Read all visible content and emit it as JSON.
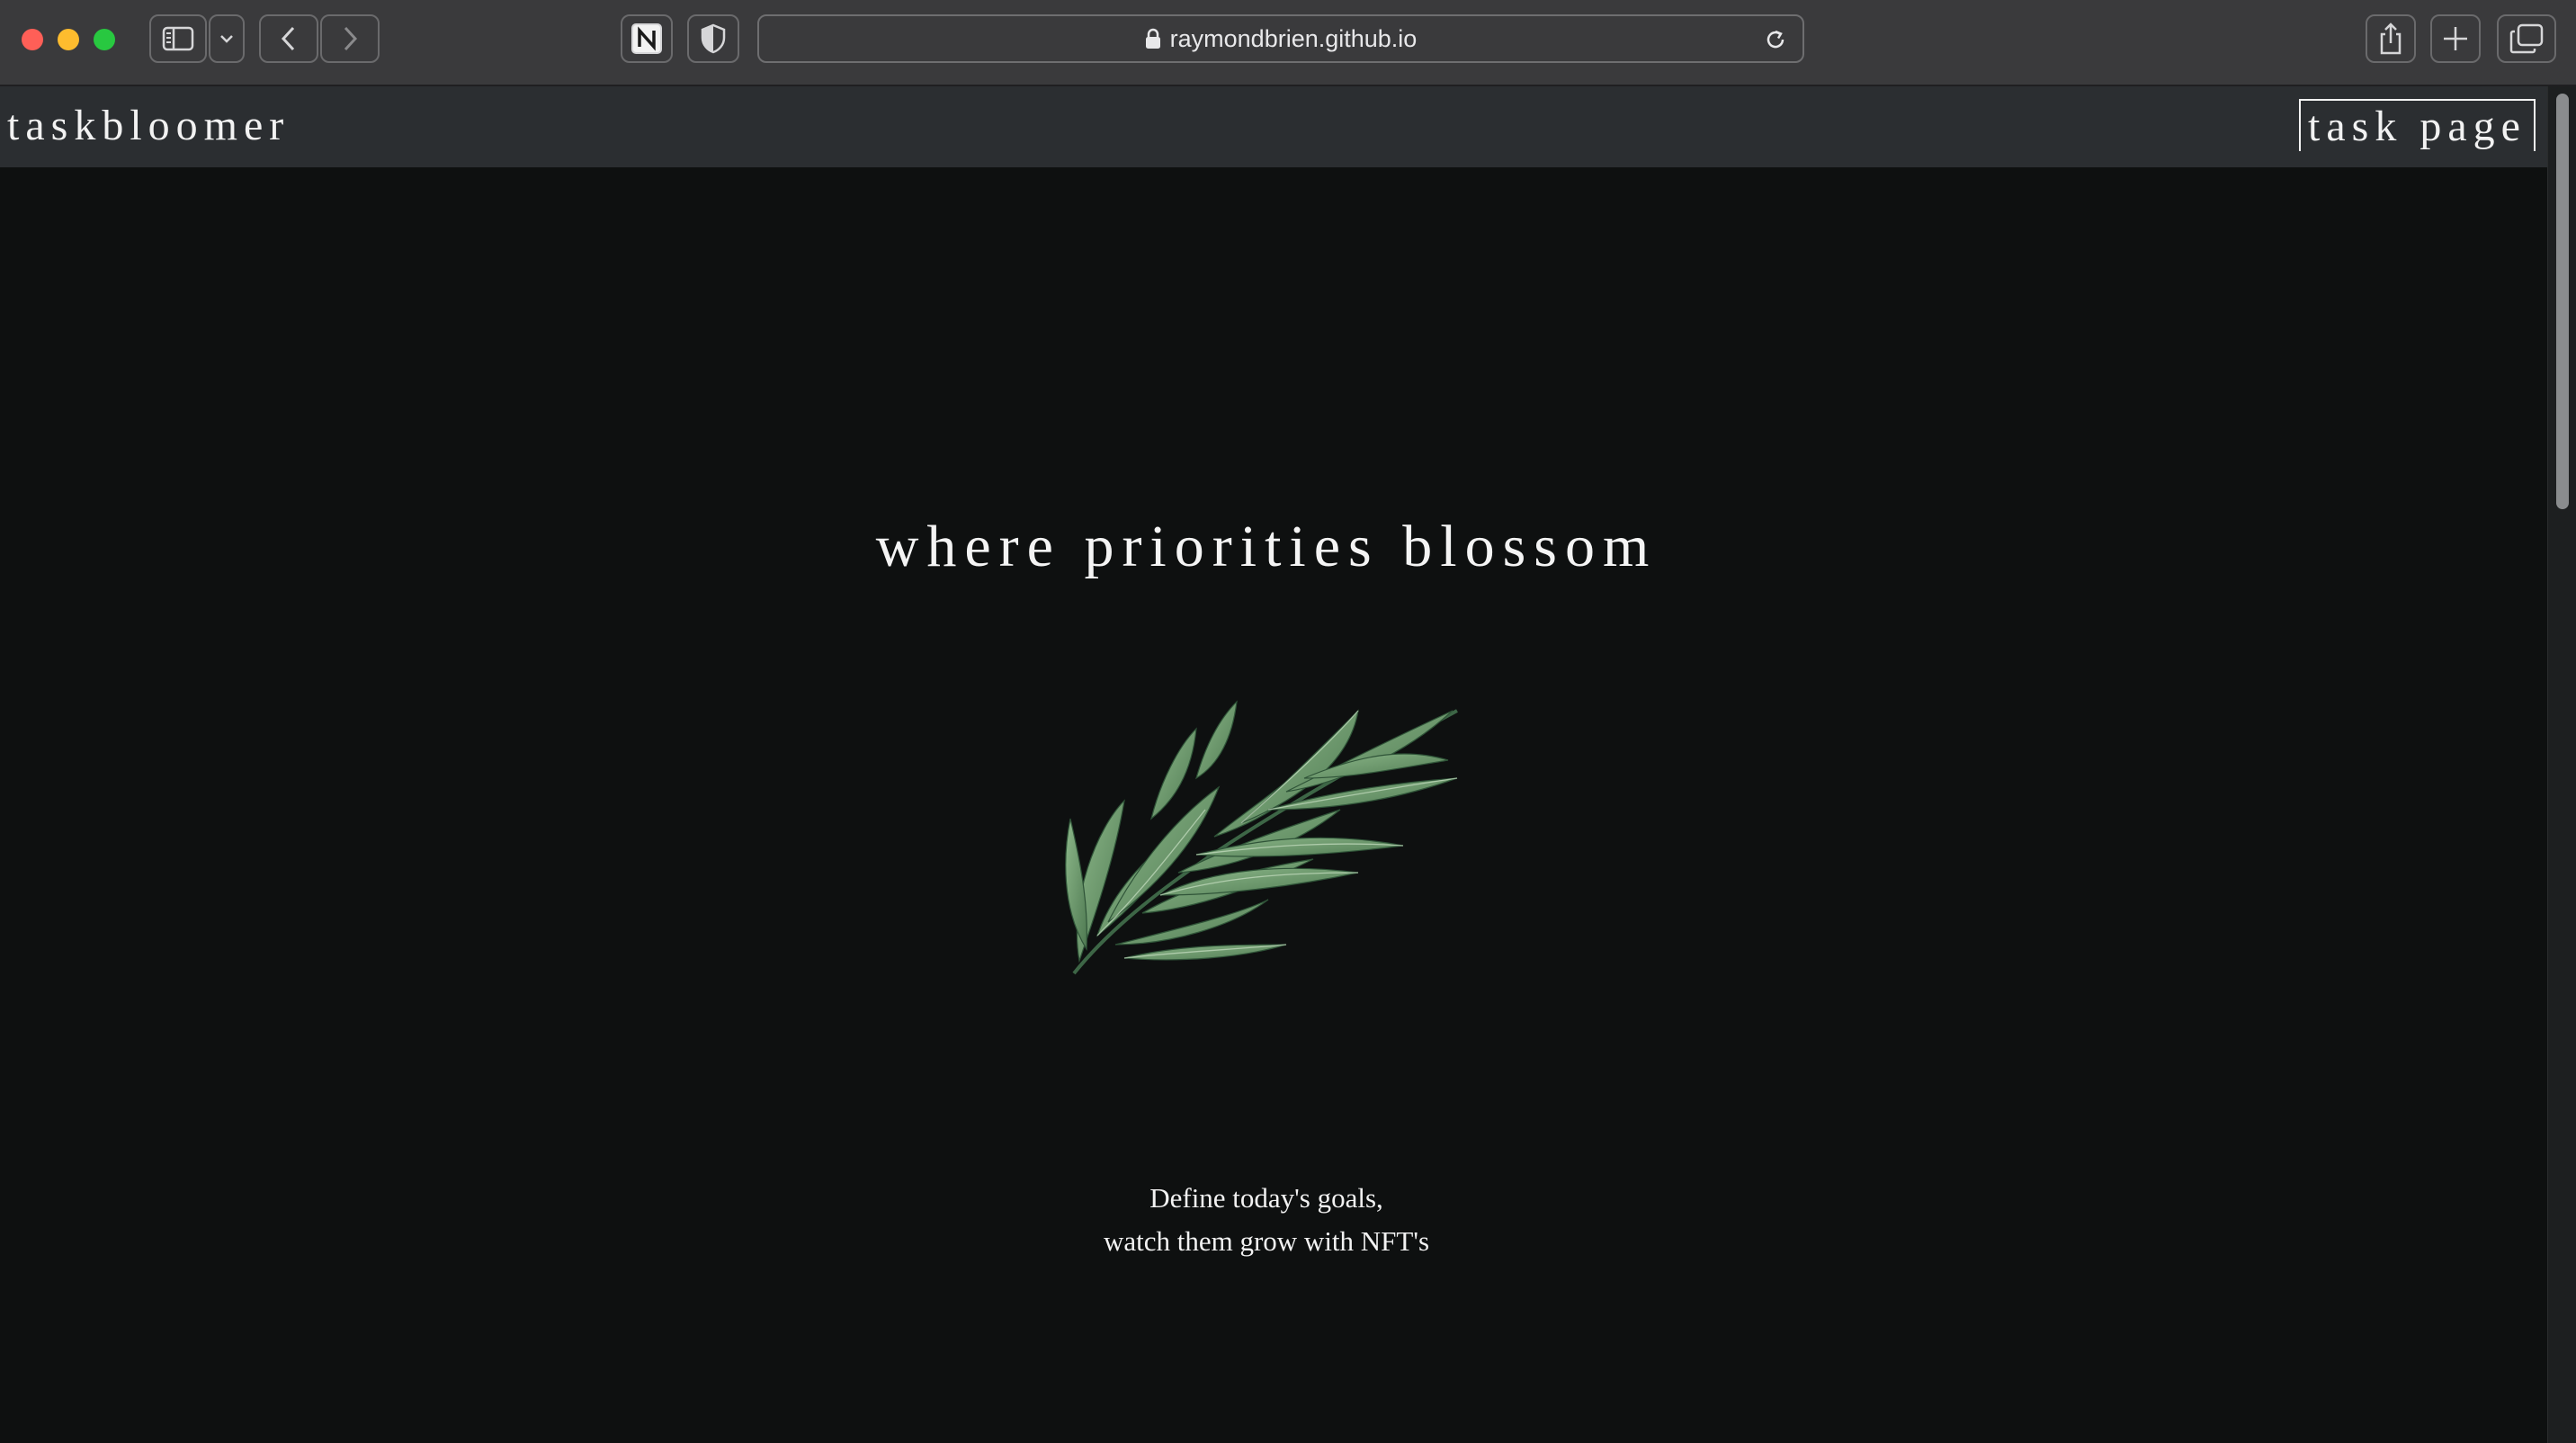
{
  "browser": {
    "url": "raymondbrien.github.io",
    "icons": [
      "sidebar-icon",
      "chevron-down-icon",
      "back-icon",
      "forward-icon",
      "notion-extension-icon",
      "shield-icon",
      "lock-icon",
      "reload-icon",
      "share-icon",
      "new-tab-icon",
      "tabs-overview-icon"
    ]
  },
  "header": {
    "brand": "taskbloomer",
    "nav_link": "task page"
  },
  "main": {
    "headline": "where priorities blossom",
    "illustration": "rosemary-sprig-illustration",
    "tagline_line1": "Define today's goals,",
    "tagline_line2": "watch them grow with NFT's"
  },
  "colors": {
    "page_background": "#0e1010",
    "header_background": "#2b2e31",
    "text": "#f2f2f2",
    "leaf_green": "#6f9a6d"
  }
}
